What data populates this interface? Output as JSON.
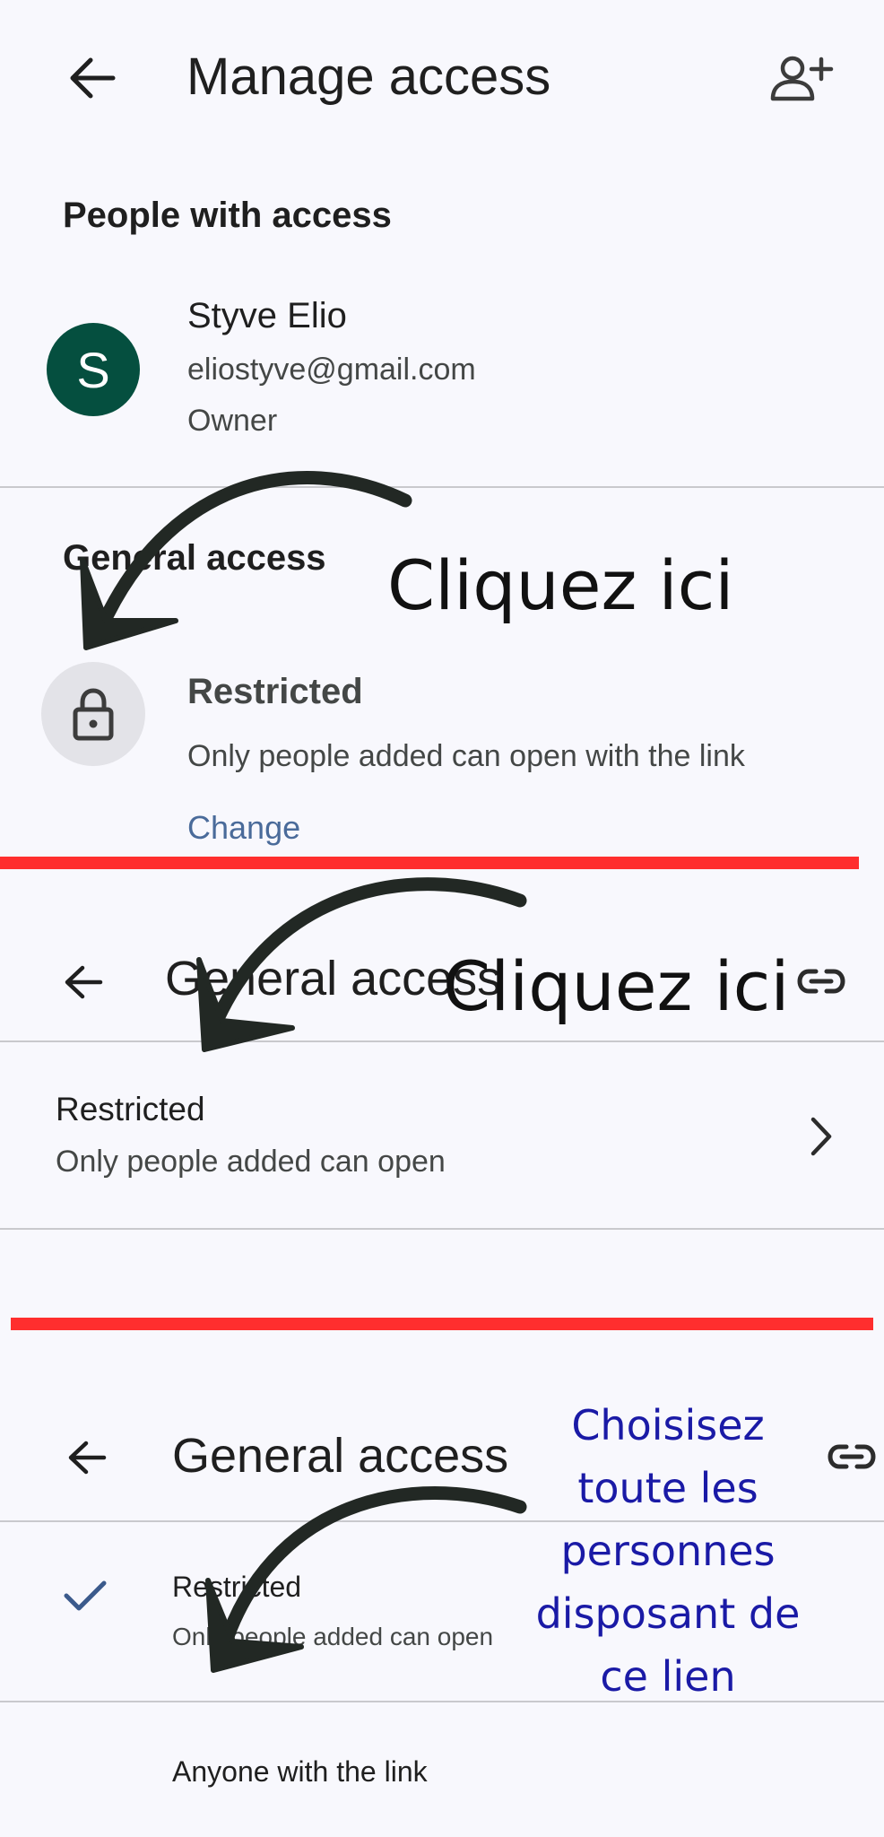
{
  "screen1": {
    "title": "Manage access",
    "people_heading": "People with access",
    "owner": {
      "initial": "S",
      "name": "Styve Elio",
      "email": "eliostyve@gmail.com",
      "role": "Owner"
    },
    "general_heading": "General access",
    "access_level": "Restricted",
    "access_description": "Only people added can open with the link",
    "change_label": "Change"
  },
  "screen2": {
    "title": "General access",
    "row_title": "Restricted",
    "row_subtitle": "Only people added can open"
  },
  "screen3": {
    "title": "General access",
    "option_restricted": "Restricted",
    "option_restricted_sub": "Only people added can open",
    "option_anyone": "Anyone with the link"
  },
  "annotations": {
    "click_here_1": "Cliquez ici",
    "click_here_2": "Cliquez ici",
    "choose_lines": [
      "Choisisez",
      "toute les",
      "personnes",
      "disposant de",
      "ce lien"
    ]
  },
  "colors": {
    "background": "#f8f8fd",
    "avatar": "#054f3f",
    "link": "#4a6b9a",
    "separator_red": "#ff2e2e",
    "annotation_blue": "#1a1aa6",
    "check": "#3b5a8c"
  },
  "icons": [
    "back-arrow-icon",
    "add-person-icon",
    "lock-icon",
    "link-icon",
    "chevron-right-icon",
    "check-icon"
  ]
}
